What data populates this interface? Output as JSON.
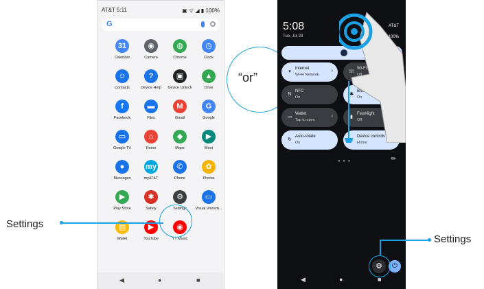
{
  "left_phone": {
    "status_left": "AT&T 5:11",
    "status_right": "▣ ᯤ ◢ ▮ 100%",
    "search_logo": "G",
    "apps": [
      {
        "label": "Calendar",
        "color": "#4285F4",
        "glyph": "31"
      },
      {
        "label": "Camera",
        "color": "#5f6368",
        "glyph": "◉"
      },
      {
        "label": "Chrome",
        "color": "#34A853",
        "glyph": "◍"
      },
      {
        "label": "Clock",
        "color": "#4285F4",
        "glyph": "◷"
      },
      {
        "label": "Contacts",
        "color": "#1a73e8",
        "glyph": "☺"
      },
      {
        "label": "Device Help",
        "color": "#1a73e8",
        "glyph": "?"
      },
      {
        "label": "Device Unlock",
        "color": "#202124",
        "glyph": "▣"
      },
      {
        "label": "Drive",
        "color": "#34A853",
        "glyph": "▲"
      },
      {
        "label": "Facebook",
        "color": "#1877F2",
        "glyph": "f"
      },
      {
        "label": "Files",
        "color": "#1a73e8",
        "glyph": "▬"
      },
      {
        "label": "Gmail",
        "color": "#EA4335",
        "glyph": "M"
      },
      {
        "label": "Google",
        "color": "#4285F4",
        "glyph": "G"
      },
      {
        "label": "Google TV",
        "color": "#1a73e8",
        "glyph": "▭"
      },
      {
        "label": "Home",
        "color": "#EA4335",
        "glyph": "⌂"
      },
      {
        "label": "Maps",
        "color": "#34A853",
        "glyph": "◆"
      },
      {
        "label": "Meet",
        "color": "#00897B",
        "glyph": "▶"
      },
      {
        "label": "Messages",
        "color": "#1a73e8",
        "glyph": "●"
      },
      {
        "label": "myAT&T",
        "color": "#00a8e0",
        "glyph": "my"
      },
      {
        "label": "Phone",
        "color": "#1a73e8",
        "glyph": "✆"
      },
      {
        "label": "Photos",
        "color": "#F4B400",
        "glyph": "✿"
      },
      {
        "label": "Play Store",
        "color": "#34A853",
        "glyph": "▶"
      },
      {
        "label": "Safety",
        "color": "#d93025",
        "glyph": "✱"
      },
      {
        "label": "Settings",
        "color": "#3c4043",
        "glyph": "⚙"
      },
      {
        "label": "Visual Voicem...",
        "color": "#1a73e8",
        "glyph": "▭"
      },
      {
        "label": "Wallet",
        "color": "#FBBC04",
        "glyph": "▤"
      },
      {
        "label": "YouTube",
        "color": "#FF0000",
        "glyph": "▶"
      },
      {
        "label": "YT Music",
        "color": "#FF0000",
        "glyph": "◉"
      }
    ],
    "nav": [
      "◀",
      "●",
      "■"
    ]
  },
  "right_phone": {
    "time": "5:08",
    "date": "Tue, Jul 23",
    "carrier": "AT&T",
    "status_icons": "▣ ᯤ ◢ ▮ 100%",
    "tiles": [
      {
        "title": "Internet",
        "sub": "Wi-Fi Network",
        "state": "on",
        "chevron": "›",
        "icon": "▾"
      },
      {
        "title": "Wi-Fi Calling",
        "sub": "Off",
        "state": "off",
        "chevron": "",
        "icon": "☏"
      },
      {
        "title": "NFC",
        "sub": "On",
        "state": "off",
        "chevron": "",
        "icon": "N"
      },
      {
        "title": "Bluetooth",
        "sub": "On",
        "state": "on",
        "chevron": "",
        "icon": "✱"
      },
      {
        "title": "Wallet",
        "sub": "Tap to open",
        "state": "off",
        "chevron": "›",
        "icon": "▭"
      },
      {
        "title": "Flashlight",
        "sub": "Off",
        "state": "off",
        "chevron": "",
        "icon": "▮"
      },
      {
        "title": "Auto-rotate",
        "sub": "On",
        "state": "on",
        "chevron": "",
        "icon": "↻"
      },
      {
        "title": "Device controls",
        "sub": "Home",
        "state": "on",
        "chevron": "›",
        "icon": "⌂"
      }
    ],
    "page_dots": "● ● ●",
    "edit_glyph": "✎",
    "settings_glyph": "⚙",
    "power_glyph": "⏻",
    "nav": [
      "◀",
      "●",
      "■"
    ]
  },
  "callouts": {
    "settings_left": "Settings",
    "settings_right": "Settings",
    "or": "“or”"
  },
  "colors": {
    "accent": "#1aa0e3",
    "tile_on": "#d5e4ff",
    "tile_off": "#3a3c42"
  }
}
